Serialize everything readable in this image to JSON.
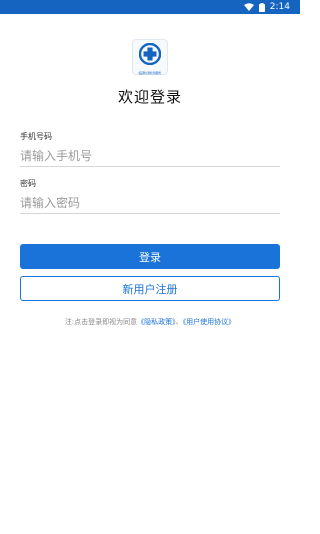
{
  "status_bar": {
    "time": "2:14",
    "icons": [
      "wifi-icon",
      "battery-icon"
    ],
    "background": "#1565c0"
  },
  "logo": {
    "icon": "medical-cross-icon",
    "caption": "临床检测检测服务"
  },
  "title": "欢迎登录",
  "phone": {
    "label": "手机号码",
    "placeholder": "请输入手机号",
    "value": ""
  },
  "password": {
    "label": "密码",
    "placeholder": "请输入密码",
    "value": ""
  },
  "buttons": {
    "login": "登录",
    "register": "新用户注册"
  },
  "agreement": {
    "prefix": "注:点击登录即视为同意",
    "privacy": "《隐私政策》",
    "separator": "、",
    "terms": "《用户使用协议》"
  },
  "colors": {
    "accent": "#1a73d9",
    "text": "#222222",
    "placeholder": "#9a9a9a"
  }
}
